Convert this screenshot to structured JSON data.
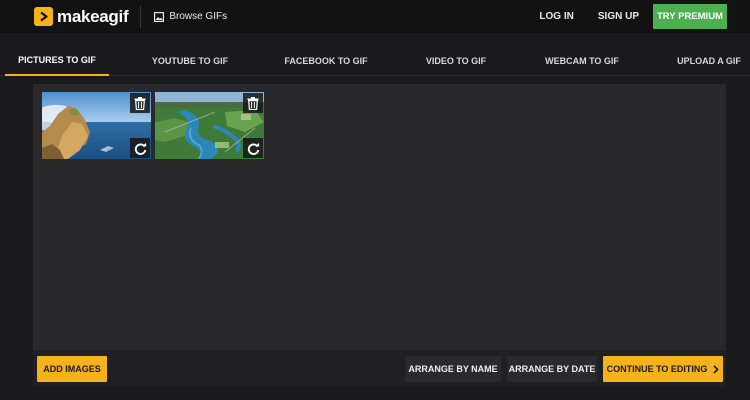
{
  "header": {
    "logo_text": "makeagif",
    "browse_label": "Browse GIFs",
    "login_label": "LOG IN",
    "signup_label": "SIGN UP",
    "premium_label": "TRY PREMIUM",
    "icons": [
      "logo-play-icon",
      "image-icon"
    ]
  },
  "tabs": [
    {
      "label": "PICTURES TO GIF",
      "active": true
    },
    {
      "label": "YOUTUBE TO GIF",
      "active": false
    },
    {
      "label": "FACEBOOK TO GIF",
      "active": false
    },
    {
      "label": "VIDEO TO GIF",
      "active": false
    },
    {
      "label": "WEBCAM TO GIF",
      "active": false
    },
    {
      "label": "UPLOAD A GIF",
      "active": false
    }
  ],
  "images": [
    {
      "subject": "coastal-cliff-photo",
      "icons": [
        "trash-icon",
        "rotate-icon"
      ]
    },
    {
      "subject": "aerial-river-photo",
      "icons": [
        "trash-icon",
        "rotate-icon"
      ]
    }
  ],
  "footer": {
    "add_images_label": "ADD IMAGES",
    "arrange_name_label": "ARRANGE BY NAME",
    "arrange_date_label": "ARRANGE BY DATE",
    "continue_label": "CONTINUE TO EDITING"
  },
  "colors": {
    "accent": "#f5b21b",
    "premium": "#4caf50",
    "background": "#1a1a1c",
    "panel": "#29282b"
  }
}
